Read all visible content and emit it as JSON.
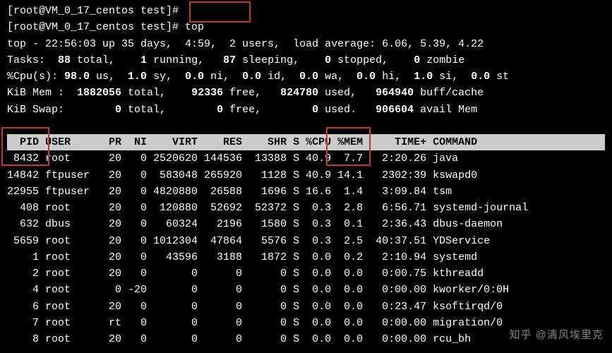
{
  "prompt1": "[root@VM_0_17_centos test]#",
  "prompt2": "[root@VM_0_17_centos test]# ",
  "cmd": "top",
  "sum": {
    "l1": "top - 22:56:03 up 35 days,  4:59,  2 users,  load average: 6.06, 5.39, 4.22",
    "tasks_lbl": "Tasks:  ",
    "tasks_total": "88 ",
    "tasks_a": "total,    ",
    "tasks_running": "1 ",
    "tasks_b": "running,   ",
    "tasks_sleeping": "87 ",
    "tasks_c": "sleeping,    ",
    "tasks_stopped": "0 ",
    "tasks_d": "stopped,    ",
    "tasks_zombie": "0 ",
    "tasks_e": "zombie",
    "cpu_lbl": "%Cpu(s): ",
    "cpu_us": "98.0 ",
    "cpu_us_l": "us,  ",
    "cpu_sy": "1.0 ",
    "cpu_sy_l": "sy,  ",
    "cpu_ni": "0.0 ",
    "cpu_ni_l": "ni,  ",
    "cpu_id": "0.0 ",
    "cpu_id_l": "id,  ",
    "cpu_wa": "0.0 ",
    "cpu_wa_l": "wa,  ",
    "cpu_hi": "0.0 ",
    "cpu_hi_l": "hi,  ",
    "cpu_si": "1.0 ",
    "cpu_si_l": "si,  ",
    "cpu_st": "0.0 ",
    "cpu_st_l": "st",
    "mem_lbl": "KiB Mem :  ",
    "mem_total": "1882056 ",
    "mem_a": "total,    ",
    "mem_free": "92336 ",
    "mem_b": "free,   ",
    "mem_used": "824780 ",
    "mem_c": "used,   ",
    "mem_buff": "964940 ",
    "mem_d": "buff/cache",
    "swap_lbl": "KiB Swap:        ",
    "swap_total": "0 ",
    "swap_a": "total,        ",
    "swap_free": "0 ",
    "swap_b": "free,        ",
    "swap_used": "0 ",
    "swap_c": "used.   ",
    "swap_avail": "906604 ",
    "swap_d": "avail Mem"
  },
  "columns": "  PID USER      PR  NI    VIRT    RES    SHR S %CPU %MEM     TIME+ COMMAND         ",
  "rows": [
    " 8432 root      20   0 2520620 144536  13388 S 40.9  7.7   2:20.26 java",
    "14842 ftpuser   20   0  583048 265920   1128 S 40.9 14.1   2302:39 kswapd0",
    "22955 ftpuser   20   0 4820880  26588   1696 S 16.6  1.4   3:09.84 tsm",
    "  408 root      20   0  120880  52692  52372 S  0.3  2.8   6:56.71 systemd-journal",
    "  632 dbus      20   0   60324   2196   1580 S  0.3  0.1   2:36.43 dbus-daemon",
    " 5659 root      20   0 1012304  47864   5576 S  0.3  2.5  40:37.51 YDService",
    "    1 root      20   0   43596   3188   1872 S  0.0  0.2   2:10.94 systemd",
    "    2 root      20   0       0      0      0 S  0.0  0.0   0:00.75 kthreadd",
    "    4 root       0 -20       0      0      0 S  0.0  0.0   0:00.00 kworker/0:0H",
    "    6 root      20   0       0      0      0 S  0.0  0.0   0:23.47 ksoftirqd/0",
    "    7 root      rt   0       0      0      0 S  0.0  0.0   0:00.00 migration/0",
    "    8 root      20   0       0      0      0 S  0.0  0.0   0:00.00 rcu_bh"
  ],
  "chart_data": {
    "type": "table",
    "title": "top process list",
    "columns": [
      "PID",
      "USER",
      "PR",
      "NI",
      "VIRT",
      "RES",
      "SHR",
      "S",
      "%CPU",
      "%MEM",
      "TIME+",
      "COMMAND"
    ],
    "rows": [
      [
        8432,
        "root",
        20,
        0,
        2520620,
        144536,
        13388,
        "S",
        40.9,
        7.7,
        "2:20.26",
        "java"
      ],
      [
        14842,
        "ftpuser",
        20,
        0,
        583048,
        265920,
        1128,
        "S",
        40.9,
        14.1,
        "2302:39",
        "kswapd0"
      ],
      [
        22955,
        "ftpuser",
        20,
        0,
        4820880,
        26588,
        1696,
        "S",
        16.6,
        1.4,
        "3:09.84",
        "tsm"
      ],
      [
        408,
        "root",
        20,
        0,
        120880,
        52692,
        52372,
        "S",
        0.3,
        2.8,
        "6:56.71",
        "systemd-journal"
      ],
      [
        632,
        "dbus",
        20,
        0,
        60324,
        2196,
        1580,
        "S",
        0.3,
        0.1,
        "2:36.43",
        "dbus-daemon"
      ],
      [
        5659,
        "root",
        20,
        0,
        1012304,
        47864,
        5576,
        "S",
        0.3,
        2.5,
        "40:37.51",
        "YDService"
      ],
      [
        1,
        "root",
        20,
        0,
        43596,
        3188,
        1872,
        "S",
        0.0,
        0.2,
        "2:10.94",
        "systemd"
      ],
      [
        2,
        "root",
        20,
        0,
        0,
        0,
        0,
        "S",
        0.0,
        0.0,
        "0:00.75",
        "kthreadd"
      ],
      [
        4,
        "root",
        0,
        -20,
        0,
        0,
        0,
        "S",
        0.0,
        0.0,
        "0:00.00",
        "kworker/0:0H"
      ],
      [
        6,
        "root",
        20,
        0,
        0,
        0,
        0,
        "S",
        0.0,
        0.0,
        "0:23.47",
        "ksoftirqd/0"
      ],
      [
        7,
        "root",
        "rt",
        0,
        0,
        0,
        0,
        "S",
        0.0,
        0.0,
        "0:00.00",
        "migration/0"
      ],
      [
        8,
        "root",
        20,
        0,
        0,
        0,
        0,
        "S",
        0.0,
        0.0,
        "0:00.00",
        "rcu_bh"
      ]
    ]
  },
  "watermark": "知乎 @清风埃里克"
}
